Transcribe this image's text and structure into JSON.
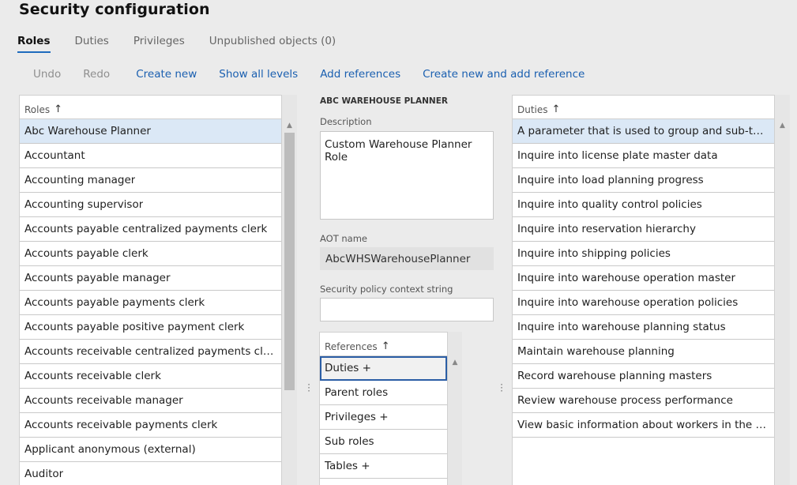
{
  "page": {
    "title": "Security configuration"
  },
  "tabs": [
    {
      "label": "Roles"
    },
    {
      "label": "Duties"
    },
    {
      "label": "Privileges"
    },
    {
      "label": "Unpublished objects (0)"
    }
  ],
  "toolbar": {
    "undo": "Undo",
    "redo": "Redo",
    "create_new": "Create new",
    "show_all_levels": "Show all levels",
    "add_references": "Add references",
    "create_new_and_add_reference": "Create new and add reference"
  },
  "roles": {
    "header": "Roles",
    "sort_icon": "arrow-up-icon",
    "items": [
      "Abc Warehouse Planner",
      "Accountant",
      "Accounting manager",
      "Accounting supervisor",
      "Accounts payable centralized payments clerk",
      "Accounts payable clerk",
      "Accounts payable manager",
      "Accounts payable payments clerk",
      "Accounts payable positive payment clerk",
      "Accounts receivable centralized payments clerk",
      "Accounts receivable clerk",
      "Accounts receivable manager",
      "Accounts receivable payments clerk",
      "Applicant anonymous (external)",
      "Auditor"
    ]
  },
  "details": {
    "title": "ABC WAREHOUSE PLANNER",
    "description_label": "Description",
    "description_value": "Custom Warehouse Planner Role",
    "aot_label": "AOT name",
    "aot_value": "AbcWHSWarehousePlanner",
    "policy_label": "Security policy context string",
    "policy_value": ""
  },
  "references": {
    "header": "References",
    "items": [
      "Duties +",
      "Parent roles",
      "Privileges +",
      "Sub roles",
      "Tables +"
    ]
  },
  "duties": {
    "header": "Duties",
    "items": [
      "A parameter that is used to group and sub-total t...",
      "Inquire into license plate master data",
      "Inquire into load planning progress",
      "Inquire into quality control policies",
      "Inquire into reservation hierarchy",
      "Inquire into shipping policies",
      "Inquire into warehouse operation master",
      "Inquire into warehouse operation policies",
      "Inquire into warehouse planning status",
      "Maintain warehouse planning",
      "Record warehouse planning masters",
      "Review warehouse process performance",
      "View basic information about workers in the syste..."
    ]
  },
  "colors": {
    "accent": "#1f6bbd",
    "link": "#1a5fb0",
    "selected_row": "#dbe8f6"
  }
}
